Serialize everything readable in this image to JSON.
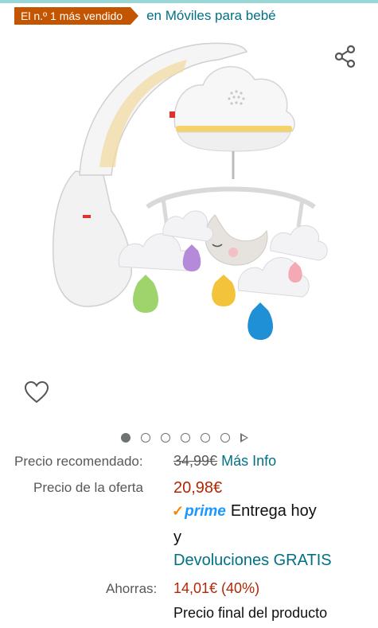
{
  "badge": {
    "text": "El n.º 1 más vendido"
  },
  "category_link": "en Móviles para bebé",
  "icons": {
    "share": "share-icon",
    "wishlist": "heart-icon"
  },
  "carousel": {
    "total_dots": 6,
    "active_index": 0
  },
  "pricing": {
    "recommended_label": "Precio recomendado:",
    "recommended_value": "34,99€",
    "more_info": "Más Info",
    "offer_label": "Precio de la oferta",
    "offer_value": "20,98€",
    "prime_label": "prime",
    "delivery": "Entrega hoy",
    "conjunction": "y",
    "returns": "Devoluciones GRATIS",
    "savings_label": "Ahorras:",
    "savings_value": "14,01€ (40%)",
    "final_price_note": "Precio final del producto"
  },
  "colors": {
    "badge_bg": "#c45500",
    "link": "#007185",
    "price": "#b12704",
    "prime_blue": "#1a98ff",
    "prime_check": "#f08804"
  }
}
